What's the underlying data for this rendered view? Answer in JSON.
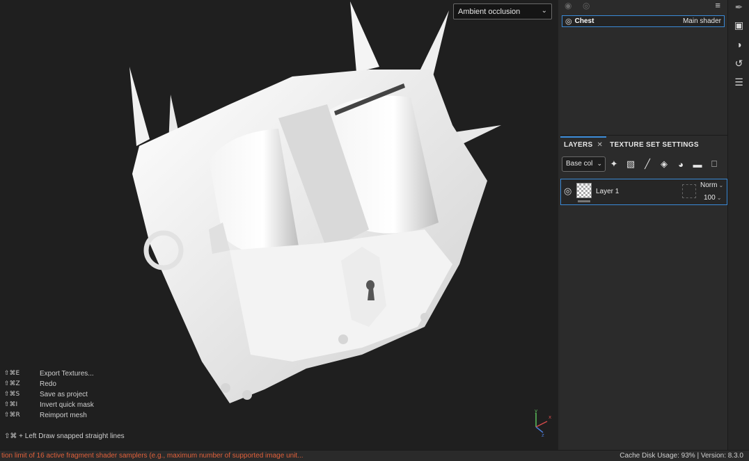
{
  "viewport": {
    "view_mode": "Ambient occlusion",
    "shortcuts": [
      {
        "key": "⇧⌘E",
        "label": "Export Textures..."
      },
      {
        "key": "⇧⌘Z",
        "label": "Redo"
      },
      {
        "key": "⇧⌘S",
        "label": "Save as project"
      },
      {
        "key": "⇧⌘I",
        "label": "Invert quick mask"
      },
      {
        "key": "⇧⌘R",
        "label": "Reimport mesh"
      }
    ],
    "snap_hint": "⇧⌘ + Left  Draw snapped straight lines",
    "gizmo": {
      "x_label": "x",
      "y_label": "y",
      "z_label": "z"
    }
  },
  "texture_set": {
    "name": "Chest",
    "shader": "Main shader"
  },
  "layers_panel": {
    "tabs": [
      {
        "label": "LAYERS"
      },
      {
        "label": "TEXTURE SET SETTINGS"
      }
    ],
    "channel": "Base col",
    "toolbar_icons": [
      "magic-wand-icon",
      "mask-icon",
      "brush-icon",
      "fill-bucket-icon",
      "smart-material-icon",
      "folder-icon",
      "trash-icon"
    ],
    "layer": {
      "name": "Layer 1",
      "blend_mode": "Norm",
      "opacity": "100"
    }
  },
  "tool_strip": [
    "pen-tool-icon",
    "camera-icon",
    "globe-icon",
    "history-icon",
    "log-icon"
  ],
  "status": {
    "error": "tion limit of 16 active fragment shader samplers (e.g., maximum number of supported image unit...",
    "right": "Cache Disk Usage:   93% | Version: 8.3.0"
  },
  "colors": {
    "accent": "#3b8bd8",
    "error": "#e0603a"
  }
}
